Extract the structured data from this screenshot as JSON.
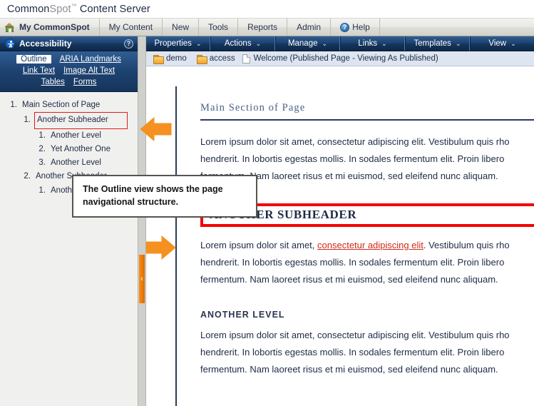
{
  "product": {
    "name_part1": "Common",
    "name_part2": "Spot",
    "trademark": "™",
    "name_part3": "Content Server"
  },
  "main_nav": {
    "home_icon": "home-icon",
    "items": [
      {
        "label": "My CommonSpot",
        "active": true
      },
      {
        "label": "My Content",
        "active": false
      },
      {
        "label": "New",
        "active": false
      },
      {
        "label": "Tools",
        "active": false
      },
      {
        "label": "Reports",
        "active": false
      },
      {
        "label": "Admin",
        "active": false
      }
    ],
    "help": {
      "label": "Help",
      "icon": "help-circle-icon",
      "glyph": "?"
    }
  },
  "left_panel": {
    "title": "Accessibility",
    "title_icon": "accessibility-person-icon",
    "help_icon": "help-circle-icon",
    "help_glyph": "?",
    "tabs_row1": [
      {
        "label": "Outline",
        "active": true
      },
      {
        "label": "ARIA Landmarks",
        "active": false
      }
    ],
    "tabs_row2": [
      {
        "label": "Link Text",
        "active": false
      },
      {
        "label": "Image Alt Text",
        "active": false
      }
    ],
    "tabs_row3": [
      {
        "label": "Tables",
        "active": false
      },
      {
        "label": "Forms",
        "active": false
      }
    ],
    "outline": [
      {
        "number": "1.",
        "label": "Main Section of Page",
        "level": 1,
        "selected": false
      },
      {
        "number": "1.",
        "label": "Another Subheader",
        "level": 2,
        "selected": true
      },
      {
        "number": "1.",
        "label": "Another Level",
        "level": 3,
        "selected": false
      },
      {
        "number": "2.",
        "label": "Yet Another One",
        "level": 3,
        "selected": false
      },
      {
        "number": "3.",
        "label": "Another Level",
        "level": 3,
        "selected": false
      },
      {
        "number": "2.",
        "label": "Another Subheader",
        "level": 2,
        "selected": false
      },
      {
        "number": "1.",
        "label": "Another Level",
        "level": 3,
        "selected": false
      }
    ],
    "splitter": {
      "name": "collapse-panel-handle",
      "glyph": "‹"
    }
  },
  "command_bar": {
    "items": [
      {
        "label": "Properties",
        "caret": "⌄"
      },
      {
        "label": "Actions",
        "caret": "⌄"
      },
      {
        "label": "Manage",
        "caret": "⌄"
      },
      {
        "label": "Links",
        "caret": "⌄"
      },
      {
        "label": "Templates",
        "caret": "⌄"
      },
      {
        "label": "View",
        "caret": "⌄"
      }
    ]
  },
  "breadcrumb": {
    "folder1": "demo",
    "folder2": "access",
    "page": "Welcome (Published Page - Viewing As Published)"
  },
  "document": {
    "heading1": "Main Section of Page",
    "para1_before": "Lorem ipsum dolor sit amet, consectetur adipiscing elit. Vestibulum quis rho",
    "para1_line2": "hendrerit. In lobortis egestas mollis. In sodales fermentum elit. Proin libero",
    "para1_line3": "fermentum. Nam laoreet risus et mi euismod, sed eleifend nunc aliquam.",
    "heading2": "ANOTHER SUBHEADER",
    "para2_pre": "Lorem ipsum dolor sit amet, ",
    "para2_link": "consectetur adipiscing elit",
    "para2_post": ". Vestibulum quis rho",
    "para2_line2": "hendrerit. In lobortis egestas mollis. In sodales fermentum elit. Proin libero",
    "para2_line3": "fermentum. Nam laoreet risus et mi euismod, sed eleifend nunc aliquam.",
    "heading3": "ANOTHER  LEVEL",
    "para3_line1": "Lorem ipsum dolor sit amet, consectetur adipiscing elit. Vestibulum quis rho",
    "para3_line2": "hendrerit. In lobortis egestas mollis. In sodales fermentum elit. Proin libero",
    "para3_line3": "fermentum. Nam laoreet risus et mi euismod, sed eleifend nunc aliquam."
  },
  "annotations": {
    "tooltip_line1": "The Outline view shows the page",
    "tooltip_line2": "navigational structure.",
    "arrow_left_name": "callout-arrow-left",
    "arrow_right_name": "callout-arrow-right"
  },
  "colors": {
    "chrome_navy": "#16355c",
    "accent_orange": "#f07b05",
    "highlight_red": "#f40000",
    "link_red": "#cf2a17",
    "breadcrumb_blue": "#dde6f0"
  }
}
